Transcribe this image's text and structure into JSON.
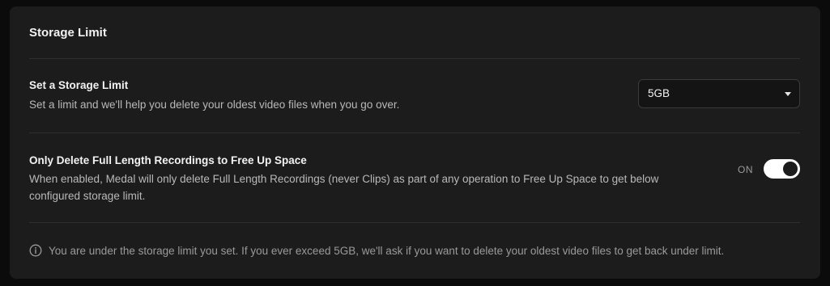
{
  "section": {
    "title": "Storage Limit"
  },
  "storage_limit": {
    "title": "Set a Storage Limit",
    "description": "Set a limit and we'll help you delete your oldest video files when you go over.",
    "selected": "5GB"
  },
  "delete_recordings": {
    "title": "Only Delete Full Length Recordings to Free Up Space",
    "description_line1": "When enabled, Medal will only delete Full Length Recordings (never Clips) as part of any operation to Free Up Space to get below",
    "description_line2": "configured storage limit.",
    "toggle_label": "ON",
    "toggle_on": true
  },
  "info": {
    "icon": "info-circle-icon",
    "text": "You are under the storage limit you set. If you ever exceed 5GB, we'll ask if you want to delete your oldest video files to get back under limit."
  },
  "colors": {
    "panel_bg": "#1c1c1c",
    "page_bg": "#0b0b0b",
    "toggle_on": "#ffffff"
  }
}
